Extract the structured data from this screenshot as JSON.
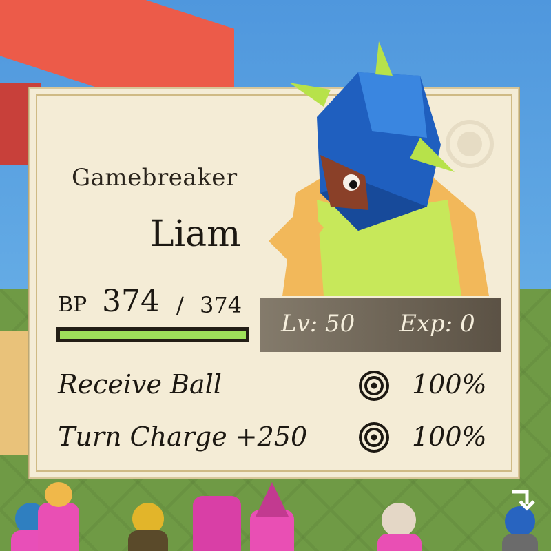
{
  "card": {
    "class_title": "Gamebreaker",
    "name": "Liam",
    "bp": {
      "label": "BP",
      "current": "374",
      "separator": "/",
      "max": "374",
      "fraction": 1.0
    },
    "level_text": "Lv: 50",
    "exp_text": "Exp: 0",
    "skills": [
      {
        "name": "Receive Ball",
        "percent": "100%",
        "icon": "target-icon"
      },
      {
        "name": "Turn Charge +250",
        "percent": "100%",
        "icon": "target-icon"
      }
    ]
  },
  "colors": {
    "card_bg": "#f4ecd6",
    "bp_fill": "#9ee05a",
    "helmet": "#1f5fbf",
    "spikes": "#b7e24a"
  },
  "icons": {
    "menu": "chevron-down-icon"
  }
}
